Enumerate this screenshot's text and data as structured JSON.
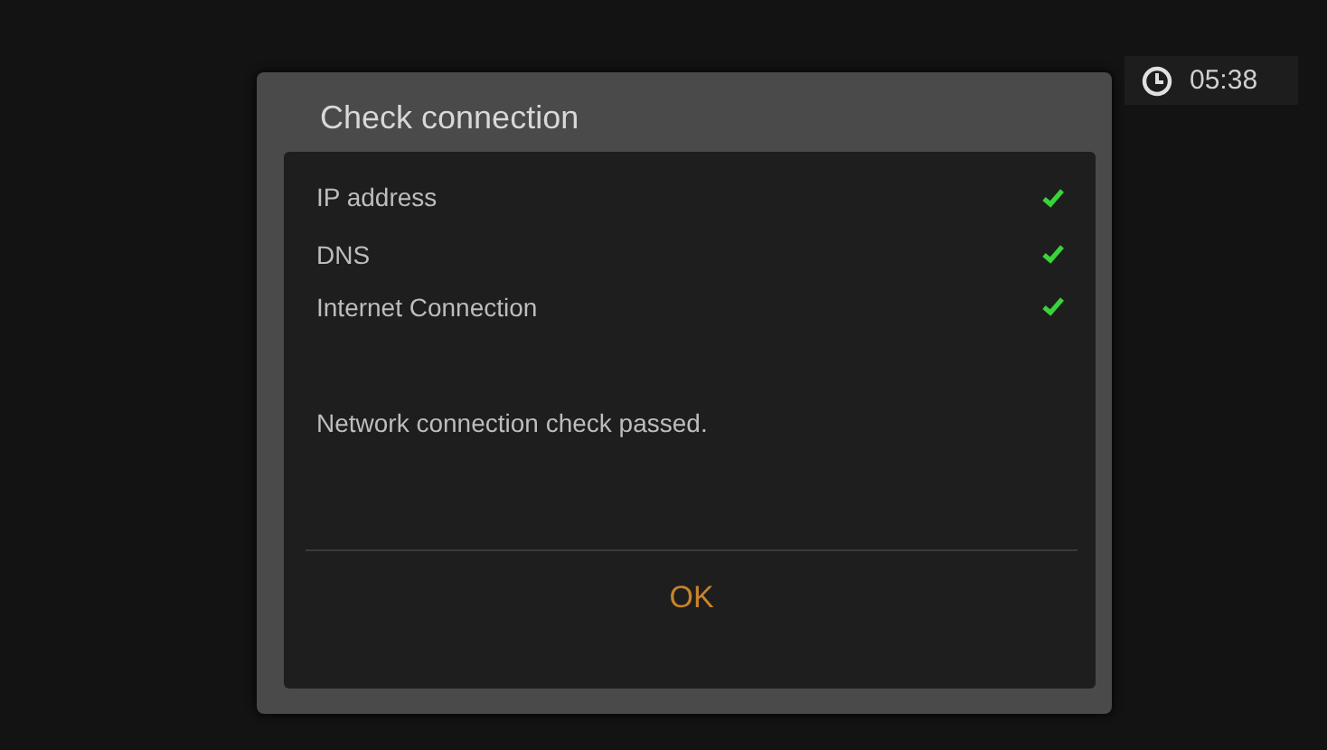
{
  "clock": {
    "time": "05:38"
  },
  "dialog": {
    "title": "Check connection",
    "items": [
      {
        "label": "IP address",
        "checked": true
      },
      {
        "label": "DNS",
        "checked": true
      },
      {
        "label": "Internet Connection",
        "checked": true
      }
    ],
    "message": "Network connection check passed.",
    "button": "OK"
  }
}
